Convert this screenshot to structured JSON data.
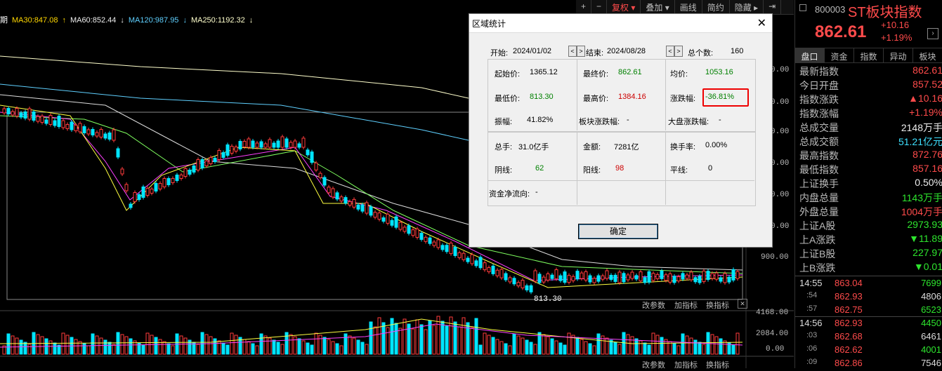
{
  "ma_bar": {
    "left_cut": "期",
    "ma30": "MA30:847.08",
    "ma60": "MA60:852.44",
    "ma120": "MA120:987.95",
    "ma250": "MA250:1192.32",
    "arrow_up": "↑",
    "arrow_down": "↓"
  },
  "toolbar": {
    "plus": "+",
    "minus": "−",
    "restore": "复权 ▾",
    "overlay": "叠加 ▾",
    "draw": "画线",
    "simple": "简约",
    "hide": "隐藏 ▸",
    "collapse": "⇥"
  },
  "price_axis": {
    "labels": [
      "0.00",
      "0.00",
      "0.00",
      "0.00",
      "0.00",
      "0.00",
      "900.00"
    ],
    "low_marker": "813.30"
  },
  "volume": {
    "params": "改参数",
    "add_indicator": "加指标",
    "switch_indicator": "换指标",
    "axis": [
      "4168.00",
      "2084.00",
      "0.00"
    ]
  },
  "bottom_bar": {
    "params": "改参数",
    "add_indicator": "加指标",
    "switch_indicator": "换指标"
  },
  "dialog": {
    "title": "区域统计",
    "close": "✕",
    "start_label": "开始:",
    "start_date": "2024/01/02",
    "end_label": "结束:",
    "end_date": "2024/08/28",
    "total_label": "总个数:",
    "total_value": "160",
    "open_label": "起始价:",
    "open_value": "1365.12",
    "close_label": "最终价:",
    "close_value": "862.61",
    "avg_label": "均价:",
    "avg_value": "1053.16",
    "low_label": "最低价:",
    "low_value": "813.30",
    "high_label": "最高价:",
    "high_value": "1384.16",
    "chg_label": "涨跌幅:",
    "chg_value": "-36.81%",
    "amp_label": "振幅:",
    "amp_value": "41.82%",
    "sector_label": "板块涨跌幅:",
    "sector_value": "-",
    "market_label": "大盘涨跌幅:",
    "market_value": "-",
    "vol_label": "总手:",
    "vol_value": "31.0亿手",
    "amount_label": "金额:",
    "amount_value": "7281亿",
    "turnover_label": "换手率:",
    "turnover_value": "0.00%",
    "neg_label": "阴线:",
    "neg_value": "62",
    "pos_label": "阳线:",
    "pos_value": "98",
    "flat_label": "平线:",
    "flat_value": "0",
    "flow_label": "资金净流向:",
    "flow_value": "-",
    "ok": "确定",
    "prev": "<",
    "next": ">"
  },
  "right": {
    "code": "800003",
    "name": "ST板块指数",
    "price": "862.61",
    "change": "+10.16",
    "change_pct": "+1.19%",
    "tabs": [
      "盘口",
      "资金",
      "指数",
      "异动",
      "板块"
    ],
    "stats": [
      {
        "label": "最新指数",
        "value": "862.61",
        "color": "#ff4b4b"
      },
      {
        "label": "今日开盘",
        "value": "857.52",
        "color": "#ff4b4b"
      },
      {
        "label": "指数涨跌",
        "value": "▲10.16",
        "color": "#ff4b4b"
      },
      {
        "label": "指数涨幅",
        "value": "+1.19%",
        "color": "#ff4b4b"
      },
      {
        "label": "总成交量",
        "value": "2148万手",
        "color": "#eeeeee"
      },
      {
        "label": "总成交额",
        "value": "51.21亿元",
        "color": "#3ee0ff"
      },
      {
        "label": "最高指数",
        "value": "872.76",
        "color": "#ff4b4b"
      },
      {
        "label": "最低指数",
        "value": "857.16",
        "color": "#ff4b4b"
      },
      {
        "label": "上证换手",
        "value": "0.50%",
        "color": "#eeeeee"
      },
      {
        "label": "内盘总量",
        "value": "1143万手",
        "color": "#2ee52e"
      },
      {
        "label": "外盘总量",
        "value": "1004万手",
        "color": "#ff4b4b"
      },
      {
        "label": "上证A股",
        "value": "2973.93",
        "color": "#2ee52e"
      },
      {
        "label": "上A涨跌",
        "value": "▼11.89",
        "color": "#2ee52e"
      },
      {
        "label": "上证B股",
        "value": "227.97",
        "color": "#2ee52e"
      },
      {
        "label": "上B涨跌",
        "value": "▼0.01",
        "color": "#2ee52e"
      }
    ],
    "ticks1": [
      {
        "time": "14:55",
        "price": "863.04",
        "qty": "7699"
      },
      {
        "time": ":54",
        "price": "862.93",
        "qty": "4806"
      },
      {
        "time": ":57",
        "price": "862.75",
        "qty": "6523"
      }
    ],
    "ticks2": [
      {
        "time": "14:56",
        "price": "862.93",
        "qty": "4450"
      },
      {
        "time": ":03",
        "price": "862.68",
        "qty": "6461"
      },
      {
        "time": ":06",
        "price": "862.62",
        "qty": "4001"
      },
      {
        "time": ":09",
        "price": "862.86",
        "qty": "7546"
      }
    ]
  }
}
